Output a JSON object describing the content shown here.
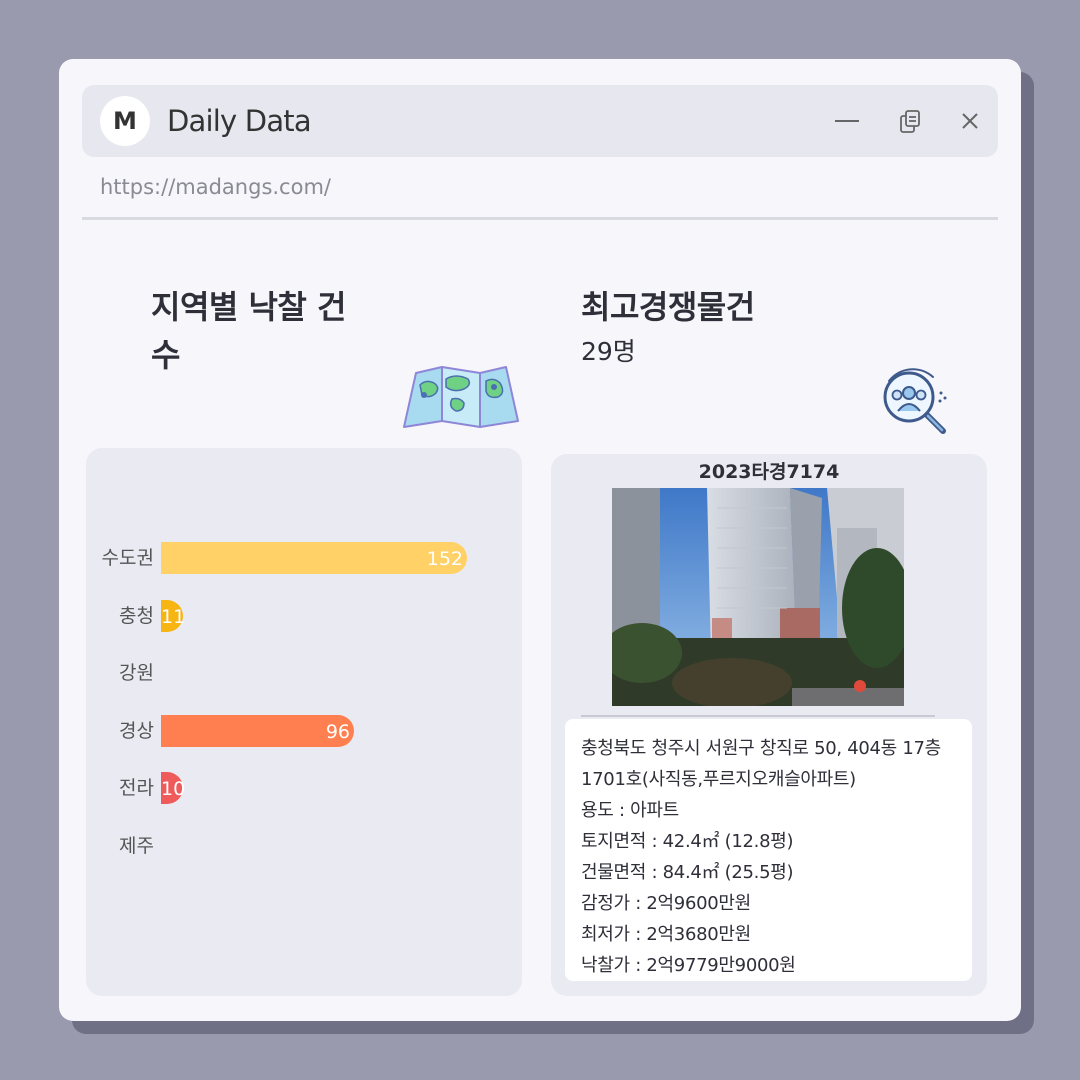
{
  "app": {
    "logo_letter": "M",
    "title": "Daily Data",
    "url": "https://madangs.com/"
  },
  "left": {
    "title": "지역별 낙찰 건수",
    "icon": "folded-map-icon"
  },
  "right": {
    "title": "최고경쟁물건",
    "value": "29명",
    "icon": "group-search-icon"
  },
  "chart_data": {
    "type": "bar",
    "orientation": "horizontal",
    "categories": [
      "수도권",
      "충청",
      "강원",
      "경상",
      "전라",
      "제주"
    ],
    "values": [
      152,
      11,
      0,
      96,
      10,
      0
    ],
    "value_labels": [
      "152",
      "11",
      "",
      "96",
      "10",
      ""
    ],
    "colors": [
      "#ffd166",
      "#f6b512",
      "#f6b512",
      "#ff7f50",
      "#ef5a5a",
      "#ef5a5a"
    ],
    "grid": false
  },
  "property": {
    "case_number": "2023타경7174",
    "details": [
      "충청북도 청주시 서원구 창직로 50, 404동 17층",
      "1701호(사직동,푸르지오캐슬아파트)",
      "용도 : 아파트",
      "토지면적 : 42.4㎡ (12.8평)",
      "건물면적 : 84.4㎡ (25.5평)",
      "감정가 : 2억9600만원",
      "최저가 : 2억3680만원",
      "낙찰가 : 2억9779만9000원"
    ]
  }
}
